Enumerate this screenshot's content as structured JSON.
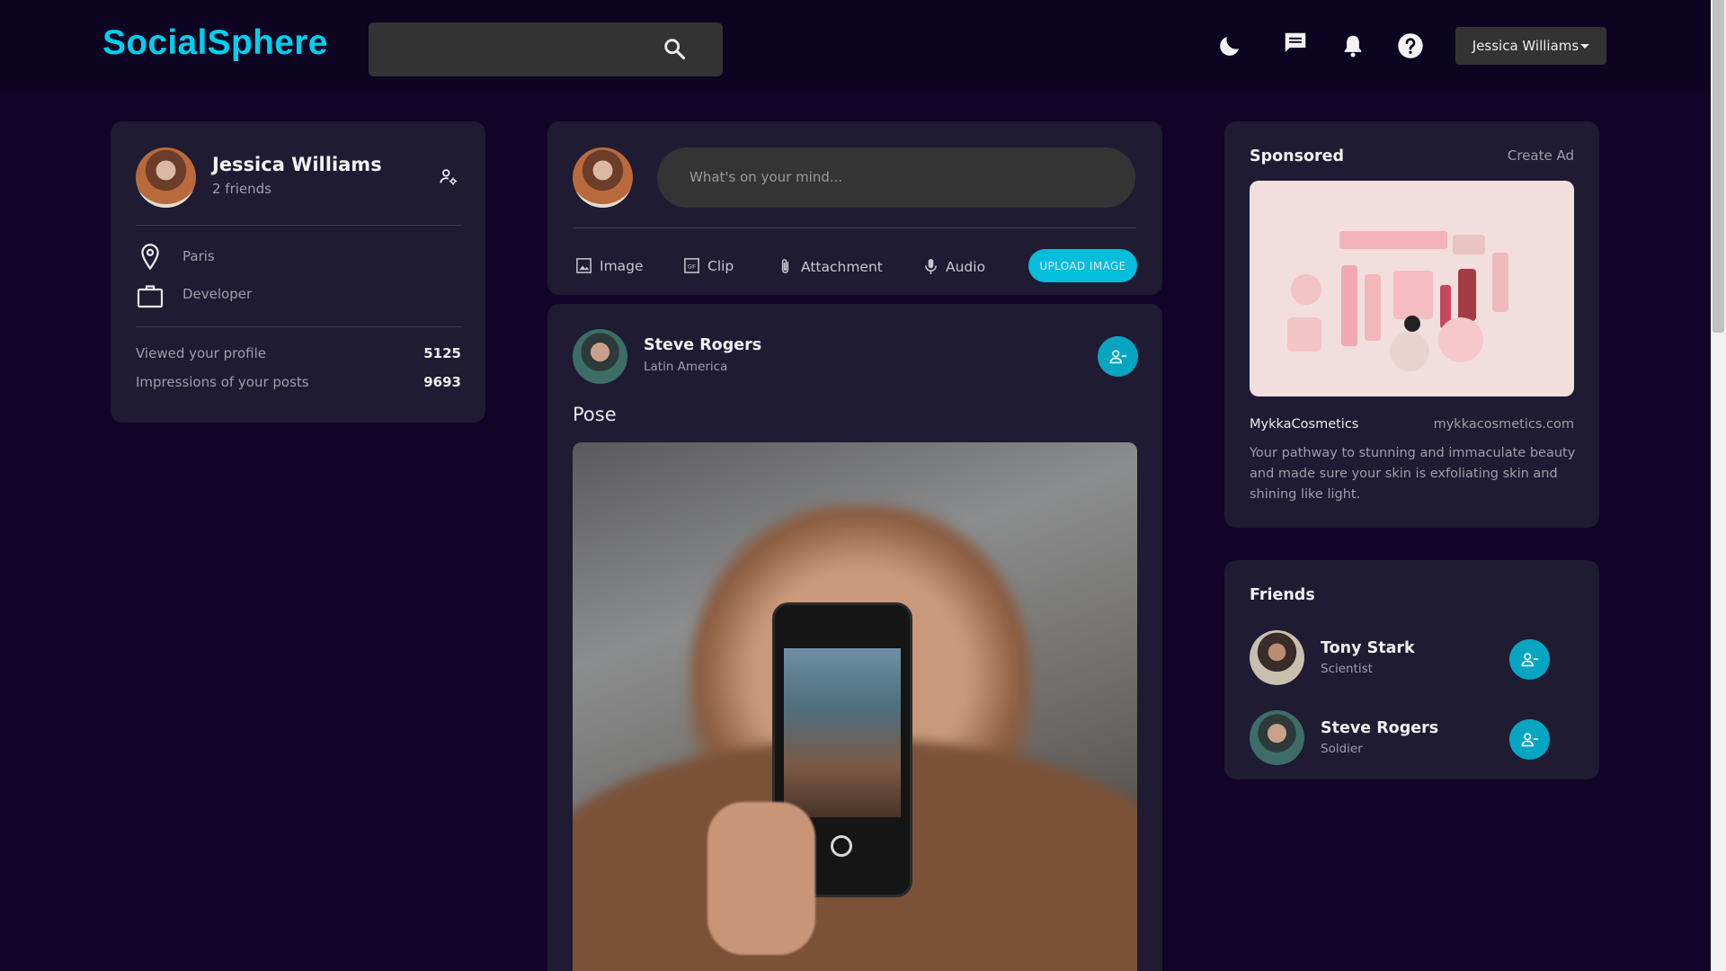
{
  "app": {
    "name": "SocialSphere",
    "accent": "#00cfee",
    "teal": "#06a5c2"
  },
  "navbar": {
    "search": {
      "value": ""
    },
    "icons": [
      "moon-icon",
      "message-icon",
      "bell-icon",
      "help-icon"
    ],
    "user_menu": "Jessica Williams"
  },
  "profile": {
    "name": "Jessica Williams",
    "friends": "2 friends",
    "location": "Paris",
    "occupation": "Developer",
    "stats": [
      {
        "label": "Viewed your profile",
        "value": "5125"
      },
      {
        "label": "Impressions of your posts",
        "value": "9693"
      }
    ]
  },
  "composer": {
    "placeholder": "What's on your mind...",
    "actions": {
      "image": "Image",
      "clip": "Clip",
      "attachment": "Attachment",
      "audio": "Audio"
    },
    "upload": "UPLOAD IMAGE"
  },
  "post": {
    "author": "Steve Rogers",
    "location": "Latin America",
    "text": "Pose"
  },
  "sponsored": {
    "title": "Sponsored",
    "create": "Create Ad",
    "brand": "MykkaCosmetics",
    "url": "mykkacosmetics.com",
    "description": "Your pathway to stunning and immaculate beauty and made sure your skin is exfoliating skin and shining like light."
  },
  "friends": {
    "title": "Friends",
    "list": [
      {
        "name": "Tony Stark",
        "role": "Scientist"
      },
      {
        "name": "Steve Rogers",
        "role": "Soldier"
      }
    ]
  }
}
